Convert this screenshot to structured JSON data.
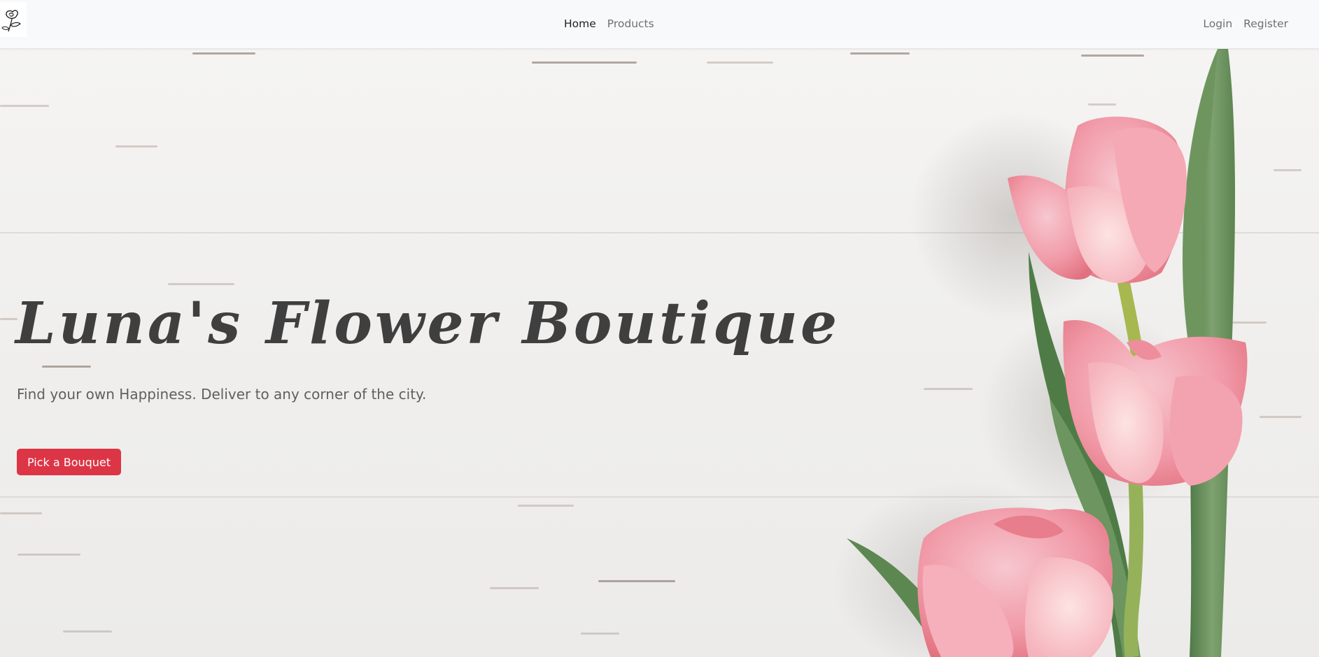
{
  "navbar": {
    "logo_icon": "rose-icon",
    "links": [
      {
        "label": "Home",
        "active": true
      },
      {
        "label": "Products",
        "active": false
      }
    ],
    "auth": {
      "login": "Login",
      "register": "Register"
    }
  },
  "hero": {
    "title": "Luna's Flower Boutique",
    "subtitle": "Find your own Happiness. Deliver to any corner of the city.",
    "cta_label": "Pick a Bouquet",
    "background": "white-wood-with-pink-tulips"
  },
  "colors": {
    "accent": "#dc3545",
    "navbar_bg": "#f8f9fa",
    "title_text": "#3f3f3f"
  }
}
